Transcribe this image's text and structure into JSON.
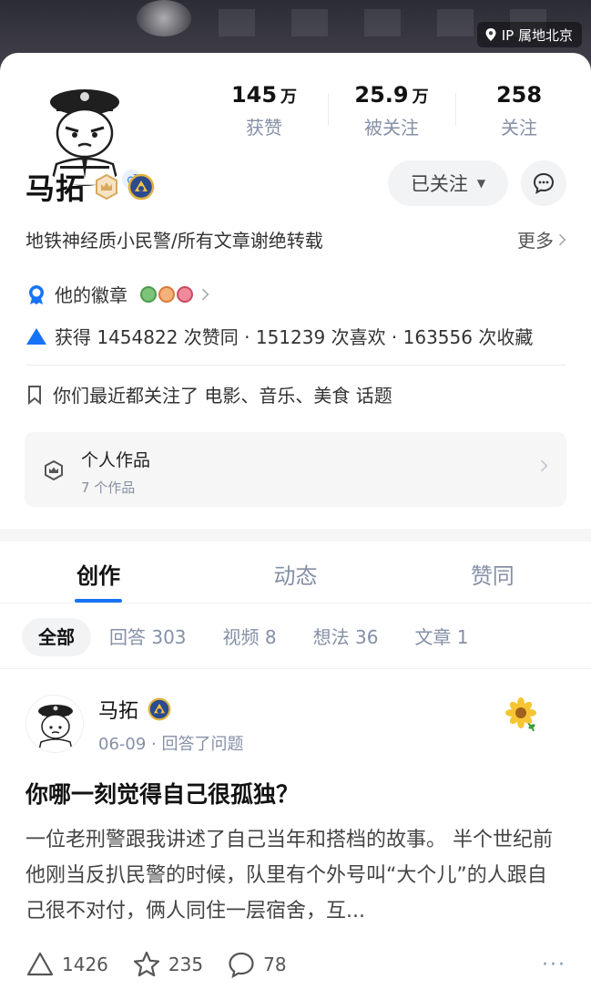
{
  "header": {
    "ip_label": "IP 属地北京"
  },
  "profile": {
    "name": "马拓",
    "gender_symbol": "♂",
    "stats": [
      {
        "value": "145",
        "unit": "万",
        "label": "获赞"
      },
      {
        "value": "25.9",
        "unit": "万",
        "label": "被关注"
      },
      {
        "value": "258",
        "unit": "",
        "label": "关注"
      }
    ],
    "follow_label": "已关注",
    "bio": "地铁神经质小民警/所有文章谢绝转载",
    "more_label": "更多",
    "badges_label": "他的徽章",
    "likes_summary": "获得 1454822 次赞同 · 151239 次喜欢 · 163556 次收藏",
    "topics_text": "你们最近都关注了 电影、音乐、美食 话题",
    "works": {
      "title": "个人作品",
      "count": "7 个作品"
    }
  },
  "tabs": [
    {
      "label": "创作",
      "active": true
    },
    {
      "label": "动态",
      "active": false
    },
    {
      "label": "赞同",
      "active": false
    }
  ],
  "filters": [
    {
      "label": "全部",
      "active": true
    },
    {
      "label": "回答 303",
      "active": false
    },
    {
      "label": "视频 8",
      "active": false
    },
    {
      "label": "想法 36",
      "active": false
    },
    {
      "label": "文章 1",
      "active": false
    }
  ],
  "post": {
    "author": "马拓",
    "meta": "06-09 · 回答了问题",
    "title": "你哪一刻觉得自己很孤独？",
    "excerpt": "一位老刑警跟我讲述了自己当年和搭档的故事。 半个世纪前他刚当反扒民警的时候，队里有个外号叫“大个儿”的人跟自己很不对付，俩人同住一层宿舍，互...",
    "upvotes": "1426",
    "favorites": "235",
    "comments": "78",
    "more_symbol": "···"
  },
  "colors": {
    "accent": "#1772f6",
    "muted": "#8590a6"
  }
}
